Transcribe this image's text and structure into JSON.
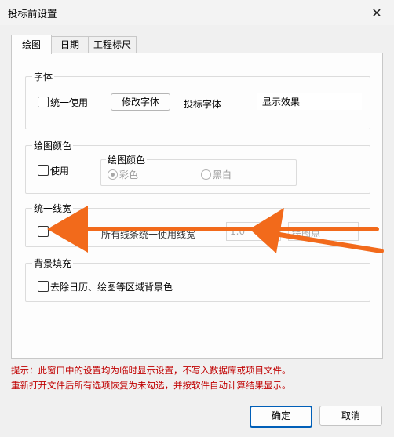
{
  "window": {
    "title": "投标前设置",
    "close_glyph": "✕"
  },
  "tabs": [
    {
      "label": "绘图",
      "active": true
    },
    {
      "label": "日期",
      "active": false
    },
    {
      "label": "工程标尺",
      "active": false
    }
  ],
  "font_group": {
    "title": "字体",
    "unify_label": "统一使用",
    "modify_button": "修改字体",
    "bid_font_label": "投标字体",
    "preview_text": "显示效果"
  },
  "color_group": {
    "title": "绘图颜色",
    "use_label": "使用",
    "sub_title": "绘图颜色",
    "option_color": "彩色",
    "option_bw": "黑白"
  },
  "line_group": {
    "title": "统一线宽",
    "label": "所有线条统一使用线宽",
    "value": "1.0",
    "unit": "绘图点"
  },
  "bg_group": {
    "title": "背景填充",
    "remove_label": "去除日历、绘图等区域背景色"
  },
  "hints": [
    "提示：此窗口中的设置均为临时显示设置，不写入数据库或项目文件。",
    "重新打开文件后所有选项恢复为未勾选，并按软件自动计算结果显示。"
  ],
  "buttons": {
    "ok": "确定",
    "cancel": "取消"
  },
  "colors": {
    "accent": "#005fb8",
    "hint": "#c00000",
    "annotation_arrow": "#f26a1b"
  }
}
